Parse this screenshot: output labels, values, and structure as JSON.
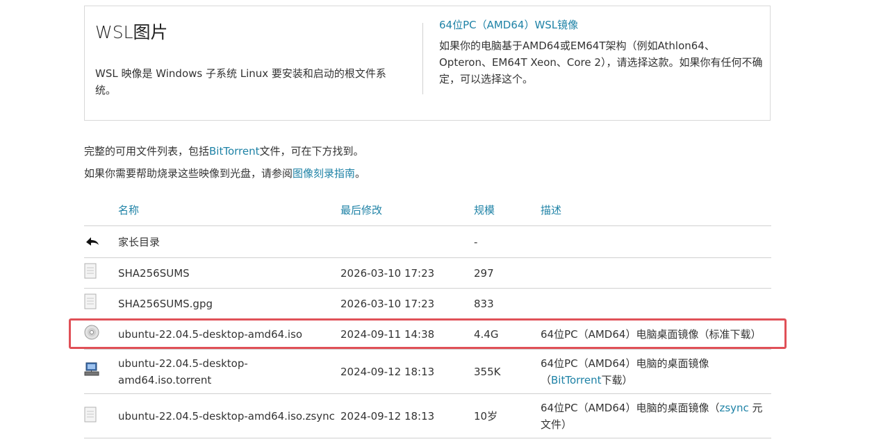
{
  "wsl": {
    "title": "WSL图片",
    "description": "WSL 映像是 Windows 子系统 Linux 要安装和启动的根文件系统。",
    "image_link": "64位PC（AMD64）WSL镜像",
    "image_description": "如果你的电脑基于AMD64或EM64T架构（例如Athlon64、Opteron、EM64T Xeon、Core 2），请选择这款。如果你有任何不确定，可以选择这个。"
  },
  "intro": {
    "line1_before": "完整的可用文件列表，包括",
    "line1_link": "BitTorrent",
    "line1_after": "文件，可在下方找到。",
    "line2_before": "如果你需要帮助烧录这些映像到光盘，请参阅",
    "line2_link": "图像刻录指南",
    "line2_after": "。"
  },
  "table": {
    "headers": {
      "name": "名称",
      "modified": "最后修改",
      "size": "规模",
      "description": "描述"
    },
    "rows": [
      {
        "icon": "parent-directory-icon",
        "name": "家长目录",
        "modified": "",
        "size": "-",
        "description": ""
      },
      {
        "icon": "text-file-icon",
        "name": "SHA256SUMS",
        "modified": "2026-03-10 17:23",
        "size": "297",
        "description": ""
      },
      {
        "icon": "text-file-icon",
        "name": "SHA256SUMS.gpg",
        "modified": "2026-03-10 17:23",
        "size": "833",
        "description": ""
      },
      {
        "icon": "disc-image-icon",
        "name": "ubuntu-22.04.5-desktop-amd64.iso",
        "modified": "2024-09-11 14:38",
        "size": "4.4G",
        "description": "64位PC（AMD64）电脑桌面镜像（标准下载）"
      },
      {
        "icon": "network-torrent-icon",
        "name": "ubuntu-22.04.5-desktop-amd64.iso.torrent",
        "modified": "2024-09-12 18:13",
        "size": "355K",
        "description_before": "64位PC（AMD64）电脑的桌面镜像（",
        "description_link": "BitTorrent",
        "description_after": "下载）"
      },
      {
        "icon": "text-file-icon",
        "name": "ubuntu-22.04.5-desktop-amd64.iso.zsync",
        "modified": "2024-09-12 18:13",
        "size": "10岁",
        "description_before": "64位PC（AMD64）电脑的桌面镜像（",
        "description_link": "zsync",
        "description_after": " 元文件）"
      }
    ]
  },
  "colors": {
    "link": "#1e82a6",
    "highlight_border": "#e05057",
    "border": "#d0d0d0"
  }
}
